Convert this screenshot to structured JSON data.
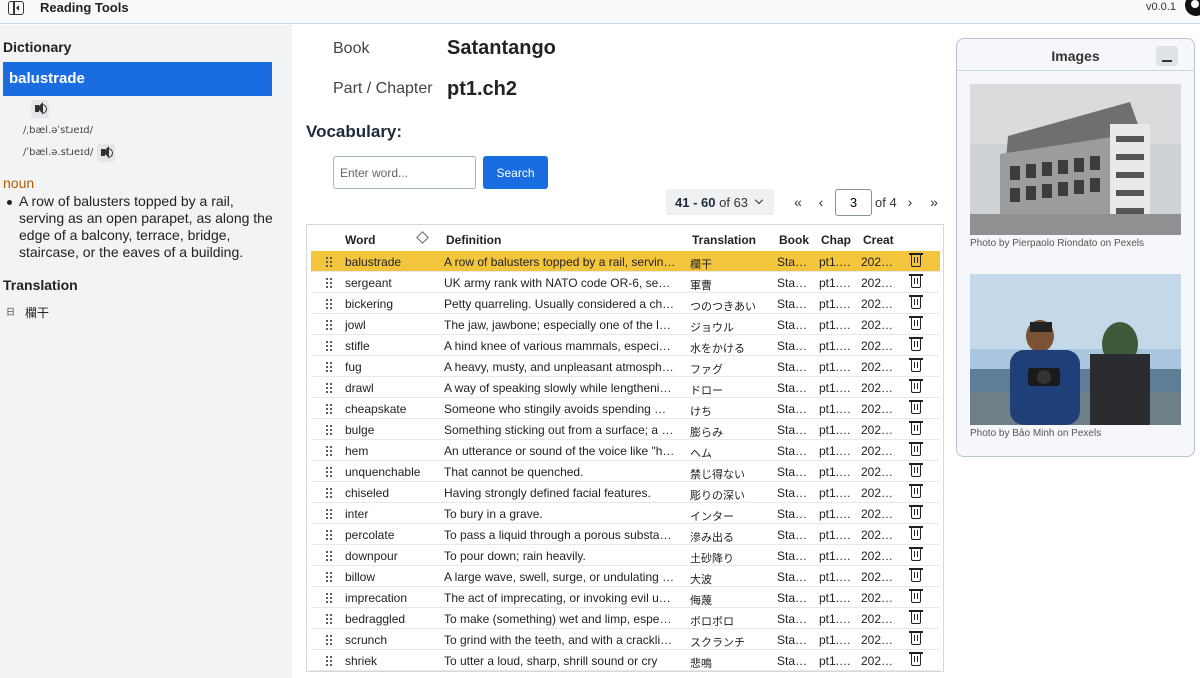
{
  "app": {
    "title": "Reading Tools",
    "version": "v0.0.1"
  },
  "dictionary": {
    "heading": "Dictionary",
    "word": "balustrade",
    "ipa_uk": "/ˌbæl.əˈstɹeɪd/",
    "ipa_us": "/ˈbæl.ə.stɹeɪd/",
    "part_of_speech": "noun",
    "definition": "A row of balusters topped by a rail, serving as an open parapet, as along the edge of a balcony, terrace, bridge, staircase, or the eaves of a building.",
    "translation_heading": "Translation",
    "translation_lang": "日",
    "translation": "欄干"
  },
  "book": {
    "book_label": "Book",
    "book_value": "Satantango",
    "chapter_label": "Part / Chapter",
    "chapter_value": "pt1.ch2"
  },
  "vocab": {
    "heading": "Vocabulary:",
    "input_placeholder": "Enter word...",
    "search_label": "Search",
    "range_text": "41 - 60",
    "range_total": "of 63",
    "page": "3",
    "page_of": "of 4",
    "columns": {
      "word": "Word",
      "definition": "Definition",
      "translation": "Translation",
      "book": "Book",
      "chapter": "Chap",
      "created": "Creat"
    },
    "rows": [
      {
        "word": "balustrade",
        "definition": "A row of balusters topped by a rail, serving as an open parapet",
        "translation": "欄干",
        "book": "Sta…",
        "chapter": "pt1.…",
        "created": "202…"
      },
      {
        "word": "sergeant",
        "definition": "UK army rank with NATO code OR-6, senior to corporal",
        "translation": "軍曹",
        "book": "Sta…",
        "chapter": "pt1.…",
        "created": "202…"
      },
      {
        "word": "bickering",
        "definition": "Petty quarreling. Usually considered a childish",
        "translation": "つのつきあい",
        "book": "Sta…",
        "chapter": "pt1.…",
        "created": "202…"
      },
      {
        "word": "jowl",
        "definition": "The jaw, jawbone; especially one of the lateral",
        "translation": "ジョウル",
        "book": "Sta…",
        "chapter": "pt1.…",
        "created": "202…"
      },
      {
        "word": "stifle",
        "definition": "A hind knee of various mammals, especially of a horse",
        "translation": "水をかける",
        "book": "Sta…",
        "chapter": "pt1.…",
        "created": "202…"
      },
      {
        "word": "fug",
        "definition": "A heavy, musty, and unpleasant atmosphere",
        "translation": "ファグ",
        "book": "Sta…",
        "chapter": "pt1.…",
        "created": "202…"
      },
      {
        "word": "drawl",
        "definition": "A way of speaking slowly while lengthening vowel sounds",
        "translation": "ドロー",
        "book": "Sta…",
        "chapter": "pt1.…",
        "created": "202…"
      },
      {
        "word": "cheapskate",
        "definition": "Someone who stingily avoids spending money",
        "translation": "けち",
        "book": "Sta…",
        "chapter": "pt1.…",
        "created": "202…"
      },
      {
        "word": "bulge",
        "definition": "Something sticking out from a surface; a swelling",
        "translation": "膨らみ",
        "book": "Sta…",
        "chapter": "pt1.…",
        "created": "202…"
      },
      {
        "word": "hem",
        "definition": "An utterance or sound of the voice like \"hem\"",
        "translation": "ヘム",
        "book": "Sta…",
        "chapter": "pt1.…",
        "created": "202…"
      },
      {
        "word": "unquenchable",
        "definition": "That cannot be quenched.",
        "translation": "禁じ得ない",
        "book": "Sta…",
        "chapter": "pt1.…",
        "created": "202…"
      },
      {
        "word": "chiseled",
        "definition": "Having strongly defined facial features.",
        "translation": "彫りの深い",
        "book": "Sta…",
        "chapter": "pt1.…",
        "created": "202…"
      },
      {
        "word": "inter",
        "definition": "To bury in a grave.",
        "translation": "インター",
        "book": "Sta…",
        "chapter": "pt1.…",
        "created": "202…"
      },
      {
        "word": "percolate",
        "definition": "To pass a liquid through a porous substance",
        "translation": "滲み出る",
        "book": "Sta…",
        "chapter": "pt1.…",
        "created": "202…"
      },
      {
        "word": "downpour",
        "definition": "To pour down; rain heavily.",
        "translation": "土砂降り",
        "book": "Sta…",
        "chapter": "pt1.…",
        "created": "202…"
      },
      {
        "word": "billow",
        "definition": "A large wave, swell, surge, or undulating mass",
        "translation": "大波",
        "book": "Sta…",
        "chapter": "pt1.…",
        "created": "202…"
      },
      {
        "word": "imprecation",
        "definition": "The act of imprecating, or invoking evil upon someone",
        "translation": "侮蔑",
        "book": "Sta…",
        "chapter": "pt1.…",
        "created": "202…"
      },
      {
        "word": "bedraggled",
        "definition": "To make (something) wet and limp, especially",
        "translation": "ボロボロ",
        "book": "Sta…",
        "chapter": "pt1.…",
        "created": "202…"
      },
      {
        "word": "scrunch",
        "definition": "To grind with the teeth, and with a crackling sound",
        "translation": "スクランチ",
        "book": "Sta…",
        "chapter": "pt1.…",
        "created": "202…"
      },
      {
        "word": "shriek",
        "definition": "To utter a loud, sharp, shrill sound or cry",
        "translation": "悲鳴",
        "book": "Sta…",
        "chapter": "pt1.…",
        "created": "202…"
      }
    ],
    "selected_row": 0
  },
  "images": {
    "heading": "Images",
    "photos": [
      {
        "credit": "Photo by Pierpaolo Riondato on Pexels"
      },
      {
        "credit": "Photo by Bảo Minh on Pexels"
      }
    ]
  },
  "colors": {
    "accent": "#1a6de0",
    "selected_row": "#f3c53c",
    "part_of_speech": "#b45a00"
  }
}
